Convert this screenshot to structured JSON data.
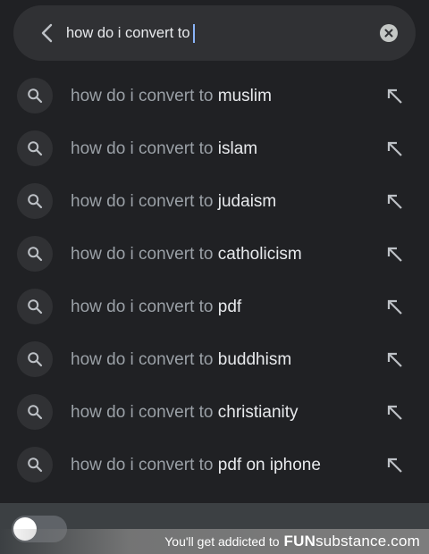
{
  "search": {
    "query": "how do i convert to",
    "back_icon": "chevron-left-icon",
    "clear_icon": "close-icon"
  },
  "suggestions": [
    {
      "prefix": "how do i convert to",
      "completion": "muslim"
    },
    {
      "prefix": "how do i convert to",
      "completion": "islam"
    },
    {
      "prefix": "how do i convert to",
      "completion": "judaism"
    },
    {
      "prefix": "how do i convert to",
      "completion": "catholicism"
    },
    {
      "prefix": "how do i convert to",
      "completion": "pdf"
    },
    {
      "prefix": "how do i convert to",
      "completion": "buddhism"
    },
    {
      "prefix": "how do i convert to",
      "completion": "christianity"
    },
    {
      "prefix": "how do i convert to",
      "completion": "pdf on iphone"
    }
  ],
  "icons": {
    "suggestion": "search-icon",
    "fill": "arrow-up-left-icon"
  },
  "colors": {
    "background": "#202124",
    "search_bar": "#303134",
    "caret": "#8ab4f8",
    "prefix_text": "#9aa0a6",
    "completion_text": "#e8eaed"
  },
  "watermark": {
    "tagline": "You'll get addicted to",
    "brand_prefix": "FUN",
    "brand_suffix": "substance.com"
  }
}
